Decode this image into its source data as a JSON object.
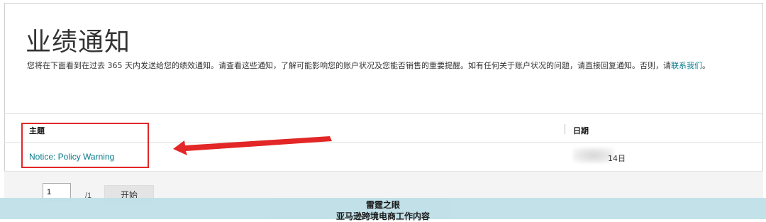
{
  "page": {
    "title": "业绩通知",
    "description_prefix": "您将在下面看到在过去 365 天内发送给您的绩效通知。请查看这些通知，了解可能影响您的账户状况及您能否销售的重要提醒。如有任何关于账户状况的问题，请直接回复通知。否则，请",
    "contact_link": "联系我们",
    "description_suffix": "。"
  },
  "table": {
    "columns": {
      "subject": "主题",
      "date": "日期"
    },
    "rows": [
      {
        "subject": "Notice: Policy Warning",
        "date_visible": "14日"
      }
    ]
  },
  "pagination": {
    "current_page": "1",
    "total": "/1",
    "go_label": "开始"
  },
  "annotation": {
    "highlight_color": "#e32626"
  },
  "watermark": {
    "line1": "雷霆之眼",
    "line2": "亚马逊跨境电商工作内容"
  }
}
